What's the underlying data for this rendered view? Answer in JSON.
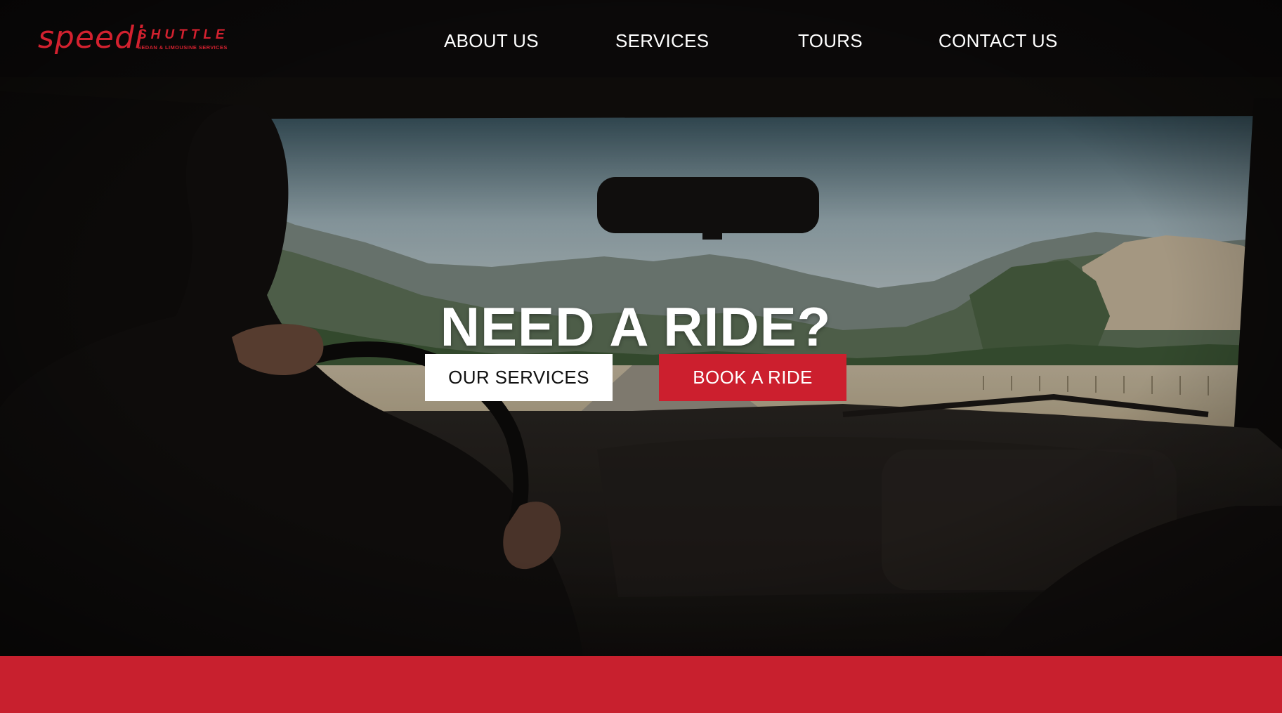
{
  "brand": {
    "script": "speedi",
    "word": "SHUTTLE",
    "tagline": "SEDAN & LIMOUSINE SERVICES",
    "color": "#d3212f"
  },
  "nav": {
    "items": [
      {
        "label": "ABOUT US"
      },
      {
        "label": "SERVICES"
      },
      {
        "label": "TOURS"
      },
      {
        "label": "CONTACT US"
      }
    ]
  },
  "hero": {
    "headline": "NEED A RIDE?",
    "primary_button": "OUR SERVICES",
    "secondary_button": "BOOK A RIDE",
    "background_image": "driver-view-through-windshield-mountain-road"
  },
  "colors": {
    "accent": "#c8202e",
    "button_light": "#ffffff",
    "text": "#ffffff"
  }
}
